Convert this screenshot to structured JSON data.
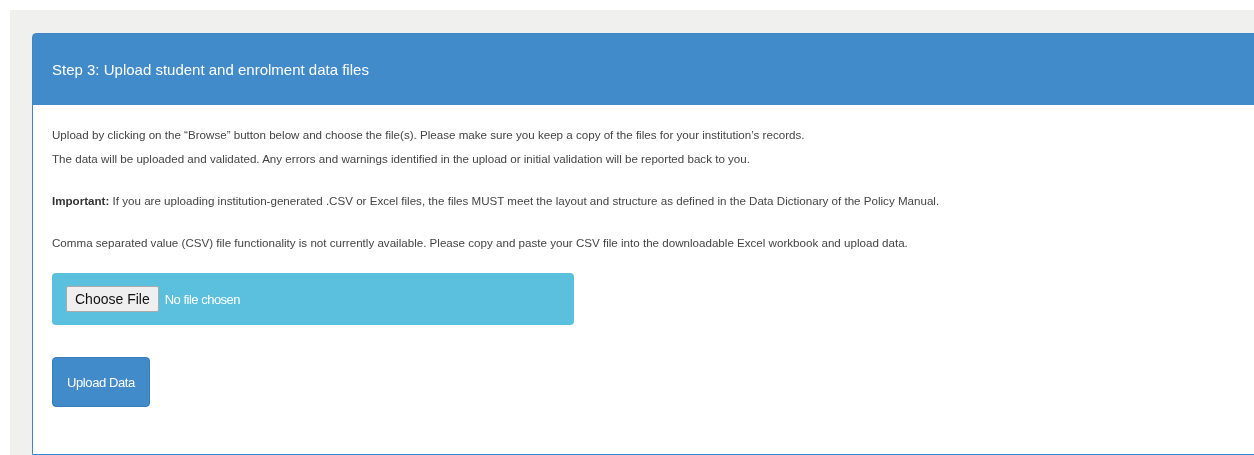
{
  "panel": {
    "title": "Step 3: Upload student and enrolment data files"
  },
  "paragraphs": [
    {
      "lines": [
        "Upload by clicking on the “Browse” button below and choose the file(s). Please make sure you keep a copy of the files for your institution’s records.",
        "The data will be uploaded and validated. Any errors and warnings identified in the upload or initial validation will be reported back to you."
      ]
    },
    {
      "lines": [
        "**Important:** If you are uploading institution-generated .CSV or Excel files, the files MUST meet the layout and structure as defined in the Data Dictionary of the Policy Manual."
      ]
    },
    {
      "lines": [
        "Comma separated value (CSV) file functionality is not currently available. Please copy and paste your CSV file into the downloadable Excel workbook and upload data."
      ]
    }
  ],
  "file_input": {
    "button": "Choose File",
    "status": "No file chosen"
  },
  "submit_button": "Upload Data"
}
